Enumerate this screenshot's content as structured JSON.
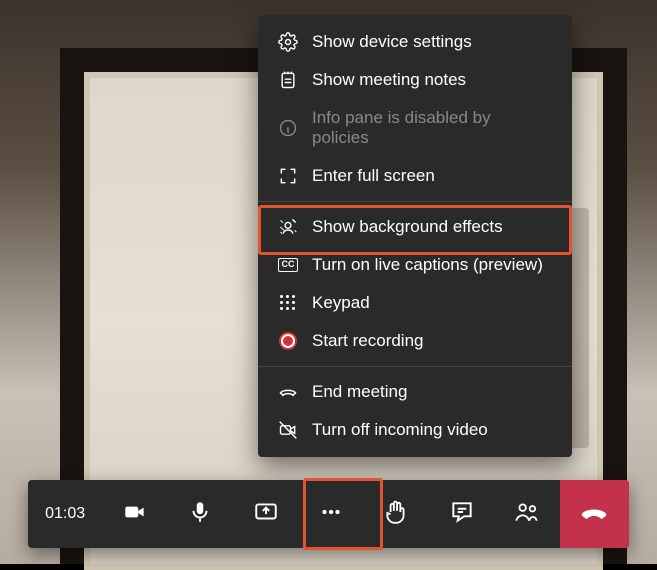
{
  "accent_highlight": "#e2532f",
  "hangup_color": "#c4314b",
  "timer": "01:03",
  "menu": {
    "items": [
      {
        "key": "device-settings",
        "label": "Show device settings",
        "disabled": false
      },
      {
        "key": "meeting-notes",
        "label": "Show meeting notes",
        "disabled": false
      },
      {
        "key": "info-pane",
        "label": "Info pane is disabled by policies",
        "disabled": true
      },
      {
        "key": "fullscreen",
        "label": "Enter full screen",
        "disabled": false
      },
      {
        "key": "background-effects",
        "label": "Show background effects",
        "disabled": false,
        "highlighted": true
      },
      {
        "key": "live-captions",
        "label": "Turn on live captions (preview)",
        "disabled": false
      },
      {
        "key": "keypad",
        "label": "Keypad",
        "disabled": false
      },
      {
        "key": "start-recording",
        "label": "Start recording",
        "disabled": false
      },
      {
        "key": "end-meeting",
        "label": "End meeting",
        "disabled": false
      },
      {
        "key": "incoming-video-off",
        "label": "Turn off incoming video",
        "disabled": false
      }
    ]
  },
  "controls": {
    "camera": "camera-icon",
    "mic": "microphone-icon",
    "share": "share-screen-icon",
    "more": "more-actions-icon",
    "raise_hand": "raise-hand-icon",
    "chat": "chat-icon",
    "participants": "participants-icon",
    "hangup": "hangup-icon"
  }
}
